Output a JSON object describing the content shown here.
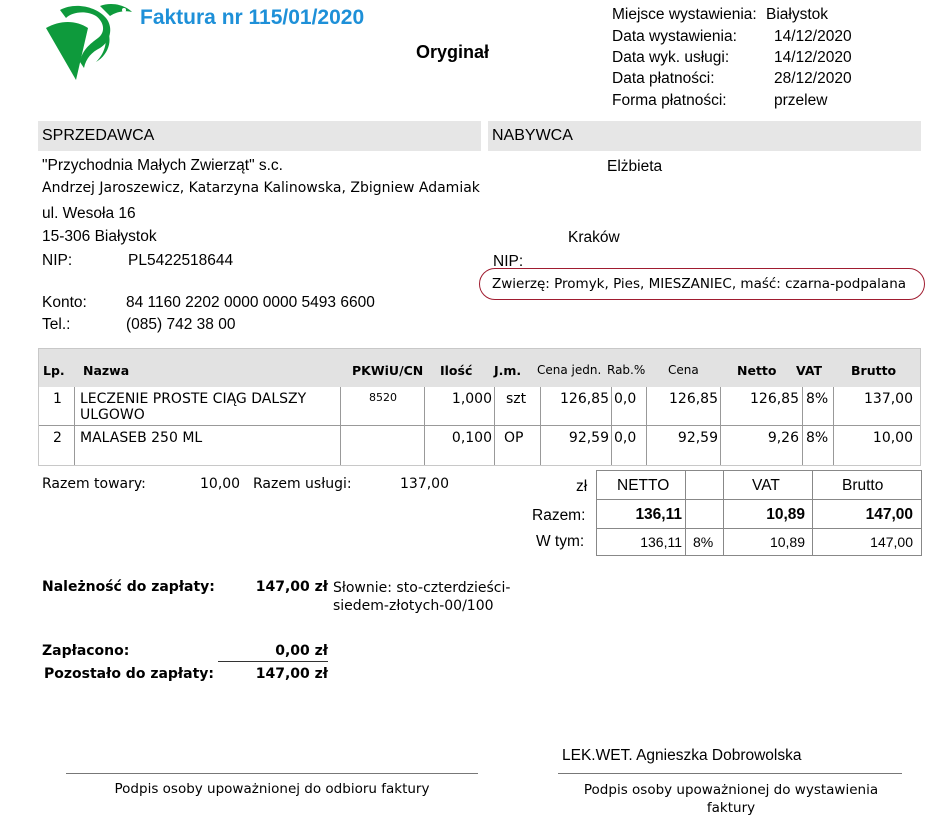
{
  "header": {
    "title": "Faktura nr 115/01/2020",
    "original_label": "Oryginał",
    "meta": [
      {
        "label": "Miejsce wystawienia:",
        "value": "Białystok"
      },
      {
        "label": "Data wystawienia:",
        "value": "14/12/2020"
      },
      {
        "label": "Data wyk. usługi:",
        "value": "14/12/2020"
      },
      {
        "label": "Data płatności:",
        "value": "28/12/2020"
      },
      {
        "label": "Forma płatności:",
        "value": "przelew"
      }
    ]
  },
  "seller": {
    "heading": "SPRZEDAWCA",
    "name": "\"Przychodnia Małych Zwierząt\" s.c.",
    "owners": "Andrzej Jaroszewicz, Katarzyna Kalinowska, Zbigniew Adamiak",
    "street": "ul. Wesoła 16",
    "city": "15-306 Białystok",
    "nip_label": "NIP:",
    "nip": "PL5422518644",
    "account_label": "Konto:",
    "account": "84 1160 2202 0000 0000 5493 6600",
    "phone_label": "Tel.:",
    "phone": "(085) 742 38 00"
  },
  "buyer": {
    "heading": "NABYWCA",
    "name": "Elżbieta",
    "city": "Kraków",
    "nip_label": "NIP:",
    "animals": "Zwierzę: Promyk, Pies, MIESZANIEC, maść: czarna-podpalana"
  },
  "items_table": {
    "headers": {
      "lp": "Lp.",
      "name": "Nazwa",
      "pkwiu": "PKWiU/CN",
      "qty": "Ilość",
      "unit": "J.m.",
      "unit_price": "Cena jedn.",
      "discount": "Rab.%",
      "price": "Cena",
      "net": "Netto",
      "vat": "VAT",
      "gross": "Brutto"
    },
    "rows": [
      {
        "lp": "1",
        "name": "LECZENIE PROSTE CIĄG DALSZY ULGOWO",
        "pkwiu": "8520",
        "qty": "1,000",
        "unit": "szt",
        "unit_price": "126,85",
        "discount": "0,0",
        "price": "126,85",
        "net": "126,85",
        "vat": "8%",
        "gross": "137,00"
      },
      {
        "lp": "2",
        "name": "MALASEB 250 ML",
        "pkwiu": "",
        "qty": "0,100",
        "unit": "OP",
        "unit_price": "92,59",
        "discount": "0,0",
        "price": "92,59",
        "net": "9,26",
        "vat": "8%",
        "gross": "10,00"
      }
    ]
  },
  "totals": {
    "goods_label": "Razem towary:",
    "goods_value": "10,00",
    "services_label": "Razem usługi:",
    "services_value": "137,00",
    "currency": "zł",
    "col_net": "NETTO",
    "col_vat": "VAT",
    "col_gross": "Brutto",
    "sum_label": "Razem:",
    "sum_net": "136,11",
    "sum_vat": "10,89",
    "sum_gross": "147,00",
    "incl_label": "W tym:",
    "incl_net": "136,11",
    "incl_rate": "8%",
    "incl_vat": "10,89",
    "incl_gross": "147,00"
  },
  "payment": {
    "due_label": "Należność do zapłaty:",
    "due_value": "147,00 zł",
    "words": "Słownie: sto-czterdzieści-siedem-złotych-00/100",
    "paid_label": "Zapłacono:",
    "paid_value": "0,00 zł",
    "remaining_label": "Pozostało do zapłaty:",
    "remaining_value": "147,00 zł"
  },
  "signatures": {
    "issuer_name": "LEK.WET. Agnieszka Dobrowolska",
    "receiver_caption": "Podpis osoby upoważnionej do odbioru faktury",
    "issuer_caption": "Podpis osoby upoważnionej do wystawienia faktury"
  },
  "colors": {
    "title": "#1e90d8",
    "logo": "#0e9a3c",
    "animals_border": "#a01c30",
    "section_bg": "#e6e6e6"
  },
  "logo_icon": "snake-logo-icon"
}
